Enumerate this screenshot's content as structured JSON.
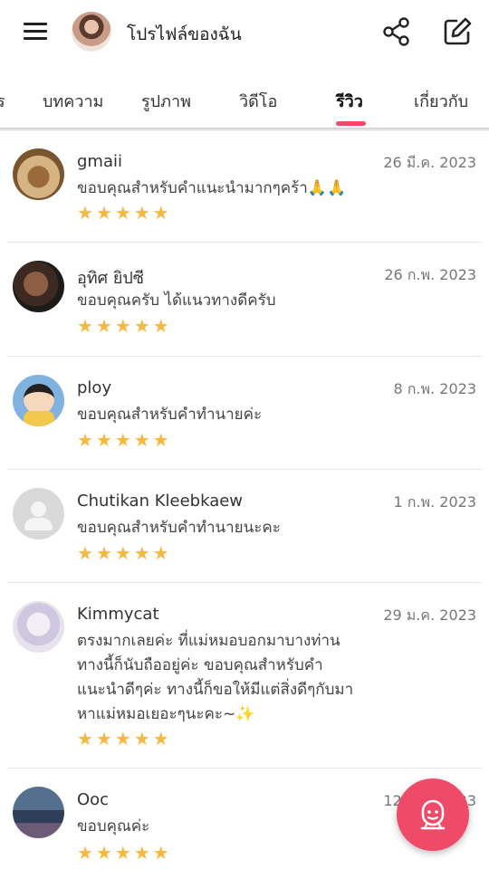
{
  "appbar": {
    "title": "โปรไฟล์ของฉัน",
    "menu_icon": "hamburger-menu-icon",
    "share_icon": "share-icon",
    "edit_icon": "edit-icon"
  },
  "tabs": [
    {
      "label": "ร"
    },
    {
      "label": "บทความ"
    },
    {
      "label": "รูปภาพ"
    },
    {
      "label": "วิดีโอ"
    },
    {
      "label": "รีวิว",
      "active": true
    },
    {
      "label": "เกี่ยวกับ"
    }
  ],
  "reviews": [
    {
      "name": "gmaii",
      "date": "26 มี.ค. 2023",
      "text": "ขอบคุณสำหรับคำแนะนำมากๆคร้า🙏🙏",
      "rating": 5
    },
    {
      "name": "อุทิศ ยิปซี",
      "date": "26 ก.พ. 2023",
      "text": "ขอบคุณครับ ได้แนวทางดีครับ",
      "rating": 5
    },
    {
      "name": "ploy",
      "date": "8 ก.พ. 2023",
      "text": "ขอบคุณสำหรับคำทำนายค่ะ",
      "rating": 5
    },
    {
      "name": "Chutikan Kleebkaew",
      "date": "1 ก.พ. 2023",
      "text": "ขอบคุณสำหรับคำทำนายนะคะ",
      "rating": 5
    },
    {
      "name": "Kimmycat",
      "date": "29 ม.ค. 2023",
      "text": "ตรงมากเลยค่ะ ที่แม่หมอบอกมาบางท่าน ทางนี้ก็นับถืออยู่ค่ะ ขอบคุณสำหรับคำแนะนำดีๆค่ะ ทางนี้ก็ขอให้มีแต่สิ่งดีๆกับมาหาแม่หมอเยอะๆนะคะ~✨",
      "rating": 5
    },
    {
      "name": "Ooc",
      "date": "12 ม.ค. 2023",
      "text": "ขอบคุณค่ะ",
      "rating": 5
    }
  ],
  "colors": {
    "accent": "#ef4a67",
    "star": "#f5b841"
  },
  "fab": {
    "icon": "fortune-teller-icon"
  }
}
